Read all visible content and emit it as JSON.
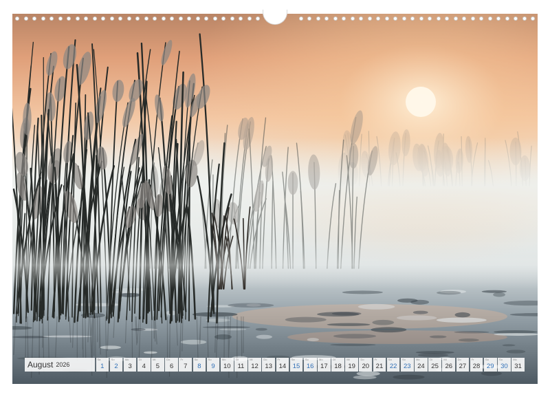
{
  "calendar": {
    "month": "August",
    "year": "2026",
    "colors": {
      "weekday": "#333333",
      "weekend": "#2f6fb6"
    },
    "days": [
      {
        "num": "1",
        "wd": "Sa",
        "weekend": true
      },
      {
        "num": "2",
        "wd": "So",
        "weekend": true
      },
      {
        "num": "3",
        "wd": "Mo",
        "weekend": false
      },
      {
        "num": "4",
        "wd": "Di",
        "weekend": false
      },
      {
        "num": "5",
        "wd": "Mi",
        "weekend": false
      },
      {
        "num": "6",
        "wd": "Do",
        "weekend": false
      },
      {
        "num": "7",
        "wd": "Fr",
        "weekend": false
      },
      {
        "num": "8",
        "wd": "Sa",
        "weekend": true
      },
      {
        "num": "9",
        "wd": "So",
        "weekend": true
      },
      {
        "num": "10",
        "wd": "Mo",
        "weekend": false
      },
      {
        "num": "11",
        "wd": "Di",
        "weekend": false
      },
      {
        "num": "12",
        "wd": "Mi",
        "weekend": false
      },
      {
        "num": "13",
        "wd": "Do",
        "weekend": false
      },
      {
        "num": "14",
        "wd": "Fr",
        "weekend": false
      },
      {
        "num": "15",
        "wd": "Sa",
        "weekend": true
      },
      {
        "num": "16",
        "wd": "So",
        "weekend": true
      },
      {
        "num": "17",
        "wd": "Mo",
        "weekend": false
      },
      {
        "num": "18",
        "wd": "Di",
        "weekend": false
      },
      {
        "num": "19",
        "wd": "Mi",
        "weekend": false
      },
      {
        "num": "20",
        "wd": "Do",
        "weekend": false
      },
      {
        "num": "21",
        "wd": "Fr",
        "weekend": false
      },
      {
        "num": "22",
        "wd": "Sa",
        "weekend": true
      },
      {
        "num": "23",
        "wd": "So",
        "weekend": true
      },
      {
        "num": "24",
        "wd": "Mo",
        "weekend": false
      },
      {
        "num": "25",
        "wd": "Di",
        "weekend": false
      },
      {
        "num": "26",
        "wd": "Mi",
        "weekend": false
      },
      {
        "num": "27",
        "wd": "Do",
        "weekend": false
      },
      {
        "num": "28",
        "wd": "Fr",
        "weekend": false
      },
      {
        "num": "29",
        "wd": "Sa",
        "weekend": true
      },
      {
        "num": "30",
        "wd": "So",
        "weekend": true
      },
      {
        "num": "31",
        "wd": "Mo",
        "weekend": false
      }
    ]
  },
  "photo": {
    "subject": "reeds-in-misty-lake-at-sunrise",
    "colors": {
      "sky_top": "#c98a5e",
      "sky_glow": "#f2b98a",
      "mist": "#e8ecea",
      "water": "#8a97a0",
      "reed": "#2a2e2c",
      "sun": "#fff6e2"
    }
  }
}
